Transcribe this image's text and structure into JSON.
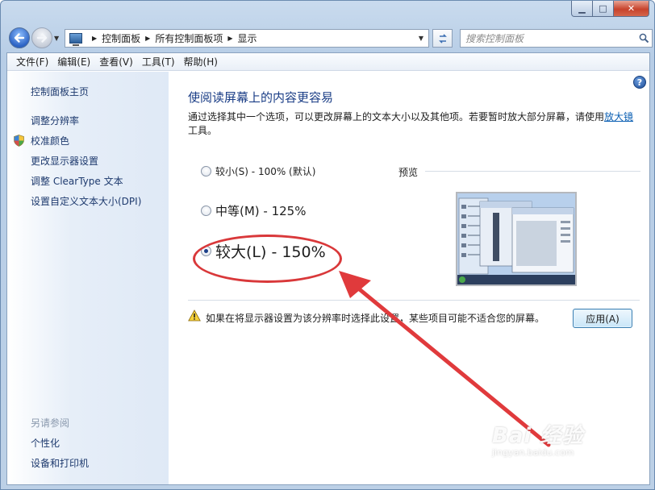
{
  "breadcrumb": [
    "控制面板",
    "所有控制面板项",
    "显示"
  ],
  "search": {
    "placeholder": "搜索控制面板"
  },
  "menu": [
    "文件(F)",
    "编辑(E)",
    "查看(V)",
    "工具(T)",
    "帮助(H)"
  ],
  "sidebar": {
    "home": "控制面板主页",
    "items": [
      {
        "label": "调整分辨率",
        "icon": null
      },
      {
        "label": "校准颜色",
        "icon": "shield-icon"
      },
      {
        "label": "更改显示器设置",
        "icon": null
      },
      {
        "label": "调整 ClearType 文本",
        "icon": null
      },
      {
        "label": "设置自定义文本大小(DPI)",
        "icon": null
      }
    ],
    "see_also_title": "另请参阅",
    "see_also": [
      "个性化",
      "设备和打印机"
    ]
  },
  "main": {
    "title": "使阅读屏幕上的内容更容易",
    "desc_prefix": "通过选择其中一个选项，可以更改屏幕上的文本大小以及其他项。若要暂时放大部分屏幕，请使用",
    "desc_link": "放大镜",
    "desc_suffix": "工具。",
    "options": [
      {
        "label": "较小(S) - 100% (默认)",
        "checked": false
      },
      {
        "label": "中等(M) - 125%",
        "checked": false
      },
      {
        "label": "较大(L) - 150%",
        "checked": true
      }
    ],
    "preview_label": "预览",
    "warning": "如果在将显示器设置为该分辨率时选择此设置，某些项目可能不适合您的屏幕。",
    "apply_label": "应用(A)"
  },
  "colors": {
    "annotation": "#d9383a",
    "link": "#0b5fb3",
    "title": "#1a3d86"
  },
  "watermark": {
    "logo": "Bai 经验",
    "site": "jingyan.baidu.com"
  }
}
